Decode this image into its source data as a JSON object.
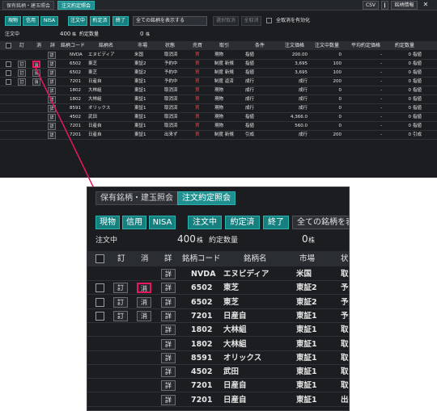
{
  "tabs": [
    "保有銘柄・建玉照会",
    "注文約定照会"
  ],
  "top_buttons": {
    "csv": "CSV",
    "divider": "❙",
    "info": "銘柄情報",
    "close": "✕"
  },
  "filters": {
    "spot": "現物",
    "margin": "信用",
    "nisa": "NISA",
    "ordering": "注文中",
    "executed": "約定済",
    "finished": "終了",
    "select_value": "全ての銘柄を表示する",
    "select_value_short": "全ての銘柄を表",
    "batch_cancel": "選択取消",
    "all_cancel": "全取消",
    "enable_all_cancel": "全取消を有効化"
  },
  "summary": {
    "ordering_label": "注文中",
    "ordering_value": "400",
    "unit": "株",
    "exec_label": "約定数量",
    "exec_value": "0"
  },
  "columns": [
    "訂",
    "消",
    "詳",
    "銘柄コード",
    "銘柄名",
    "市場",
    "状態",
    "売買",
    "取引",
    "条件",
    "注文価格",
    "注文中数量",
    "平均約定価格",
    "約定数量"
  ],
  "button_labels": {
    "correct": "訂",
    "cancel": "消",
    "detail": "詳"
  },
  "rows": [
    {
      "has_cb": false,
      "has_correct": false,
      "has_cancel": false,
      "code": "NVDA",
      "name": "エヌビディア",
      "market": "米国",
      "status": "取消済",
      "side": "買",
      "trade": "現物",
      "cond": "指値",
      "price": "200.00",
      "qty": "0",
      "avg": "-",
      "exec": "0",
      "extra": "指値"
    },
    {
      "has_cb": true,
      "has_correct": true,
      "has_cancel": true,
      "code": "6502",
      "name": "東芝",
      "market": "東証2",
      "status": "予約中",
      "side": "買",
      "trade": "制度 新規",
      "cond": "指値",
      "price": "3,695",
      "qty": "100",
      "avg": "-",
      "exec": "0",
      "extra": "指値"
    },
    {
      "has_cb": true,
      "has_correct": true,
      "has_cancel": true,
      "code": "6502",
      "name": "東芝",
      "market": "東証2",
      "status": "予約中",
      "side": "買",
      "trade": "制度 新規",
      "cond": "指値",
      "price": "3,695",
      "qty": "100",
      "avg": "-",
      "exec": "0",
      "extra": "指値"
    },
    {
      "has_cb": true,
      "has_correct": true,
      "has_cancel": true,
      "code": "7201",
      "name": "日産自",
      "market": "東証1",
      "status": "予約中",
      "side": "買",
      "trade": "制度 返済",
      "cond": "成行",
      "price": "成行",
      "qty": "200",
      "avg": "-",
      "exec": "0",
      "extra": "指値"
    },
    {
      "has_cb": false,
      "has_correct": false,
      "has_cancel": false,
      "code": "1802",
      "name": "大林組",
      "market": "東証1",
      "status": "取消済",
      "side": "買",
      "trade": "現物",
      "cond": "成行",
      "price": "成行",
      "qty": "0",
      "avg": "-",
      "exec": "0",
      "extra": "指値"
    },
    {
      "has_cb": false,
      "has_correct": false,
      "has_cancel": false,
      "code": "1802",
      "name": "大林組",
      "market": "東証1",
      "status": "取消済",
      "side": "買",
      "trade": "現物",
      "cond": "成行",
      "price": "成行",
      "qty": "0",
      "avg": "-",
      "exec": "0",
      "extra": "指値"
    },
    {
      "has_cb": false,
      "has_correct": false,
      "has_cancel": false,
      "code": "8591",
      "name": "オリックス",
      "market": "東証1",
      "status": "取消済",
      "side": "買",
      "trade": "現物",
      "cond": "成行",
      "price": "成行",
      "qty": "0",
      "avg": "-",
      "exec": "0",
      "extra": "指値"
    },
    {
      "has_cb": false,
      "has_correct": false,
      "has_cancel": false,
      "code": "4502",
      "name": "武田",
      "market": "東証1",
      "status": "取消済",
      "side": "買",
      "trade": "現物",
      "cond": "指値",
      "price": "4,366.0",
      "qty": "0",
      "avg": "-",
      "exec": "0",
      "extra": "指値"
    },
    {
      "has_cb": false,
      "has_correct": false,
      "has_cancel": false,
      "code": "7201",
      "name": "日産自",
      "market": "東証1",
      "status": "取消済",
      "side": "買",
      "trade": "現物",
      "cond": "指値",
      "price": "560.0",
      "qty": "0",
      "avg": "-",
      "exec": "0",
      "extra": "指値"
    },
    {
      "has_cb": false,
      "has_correct": false,
      "has_cancel": false,
      "code": "7201",
      "name": "日産自",
      "market": "東証1",
      "status": "出来ず",
      "side": "買",
      "trade": "制度 新規",
      "cond": "引成",
      "price": "成行",
      "qty": "200",
      "avg": "-",
      "exec": "0",
      "extra": "引成"
    }
  ],
  "colors": {
    "bg": "#1b1d21",
    "accent": "#1f8f8f",
    "buy": "#e24a4a",
    "highlight": "#e8175d"
  }
}
